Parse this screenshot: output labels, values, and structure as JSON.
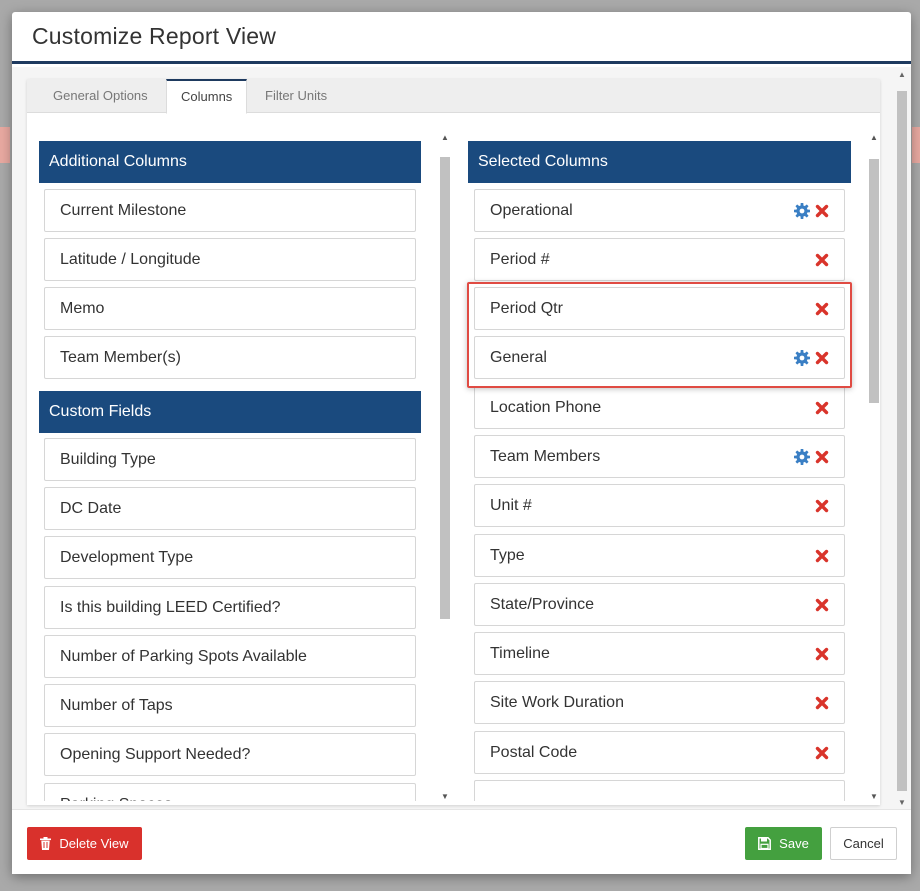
{
  "modal": {
    "title": "Customize Report View"
  },
  "tabs": [
    {
      "label": "General Options",
      "active": false
    },
    {
      "label": "Columns",
      "active": true
    },
    {
      "label": "Filter Units",
      "active": false
    }
  ],
  "additional_columns": {
    "header": "Additional Columns",
    "items": [
      "Current Milestone",
      "Latitude / Longitude",
      "Memo",
      "Team Member(s)"
    ]
  },
  "custom_fields": {
    "header": "Custom Fields",
    "items": [
      "Building Type",
      "DC Date",
      "Development Type",
      "Is this building LEED Certified?",
      "Number of Parking Spots Available",
      "Number of Taps",
      "Opening Support Needed?",
      "Parking Spaces"
    ]
  },
  "selected_columns": {
    "header": "Selected Columns",
    "items": [
      {
        "label": "Operational",
        "has_settings": true
      },
      {
        "label": "Period #",
        "has_settings": false
      },
      {
        "label": "Period Qtr",
        "has_settings": false
      },
      {
        "label": "General",
        "has_settings": true
      },
      {
        "label": "Location Phone",
        "has_settings": false
      },
      {
        "label": "Team Members",
        "has_settings": true
      },
      {
        "label": "Unit #",
        "has_settings": false
      },
      {
        "label": "Type",
        "has_settings": false
      },
      {
        "label": "State/Province",
        "has_settings": false
      },
      {
        "label": "Timeline",
        "has_settings": false
      },
      {
        "label": "Site Work Duration",
        "has_settings": false
      },
      {
        "label": "Postal Code",
        "has_settings": false
      }
    ]
  },
  "footer": {
    "delete_label": "Delete View",
    "save_label": "Save",
    "cancel_label": "Cancel"
  },
  "colors": {
    "header_blue": "#1a4a7e",
    "remove_red": "#d9342b",
    "gear_blue": "#3a7fc4",
    "highlight": "#e04b43",
    "save_green": "#44a03f",
    "delete_red": "#d9312c"
  },
  "icons": {
    "remove": "times-icon",
    "settings": "gear-icon",
    "delete": "trash-icon",
    "save": "floppy-disk-icon"
  }
}
